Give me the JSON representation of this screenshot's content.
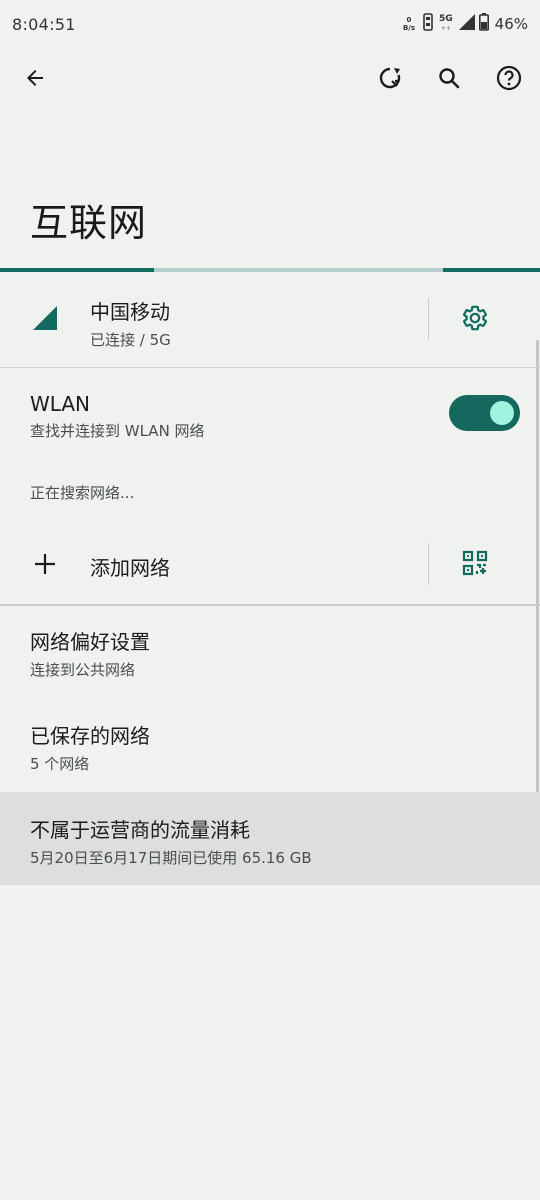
{
  "status_bar": {
    "time": "8:04:51",
    "net_speed_value": "0",
    "net_speed_unit": "B/s",
    "network_type": "5G",
    "network_sub": "++",
    "battery": "46%"
  },
  "page": {
    "title": "互联网"
  },
  "carrier": {
    "name": "中国移动",
    "status": "已连接 / 5G"
  },
  "wlan": {
    "title": "WLAN",
    "subtitle": "查找并连接到 WLAN 网络",
    "enabled": true
  },
  "searching_text": "正在搜索网络...",
  "add_network": {
    "label": "添加网络"
  },
  "network_prefs": {
    "title": "网络偏好设置",
    "subtitle": "连接到公共网络"
  },
  "saved_networks": {
    "title": "已保存的网络",
    "subtitle": "5 个网络"
  },
  "data_usage": {
    "title": "不属于运营商的流量消耗",
    "subtitle": "5月20日至6月17日期间已使用 65.16 GB"
  },
  "colors": {
    "accent": "#136b60",
    "toggle_knob": "#9ff3df",
    "background": "#eff2ef"
  },
  "icons": {
    "back": "arrow-back-icon",
    "refresh": "refresh-icon",
    "search": "search-icon",
    "help": "help-icon",
    "signal": "signal-icon",
    "settings": "gear-icon",
    "add": "plus-icon",
    "qr": "qr-code-icon"
  }
}
